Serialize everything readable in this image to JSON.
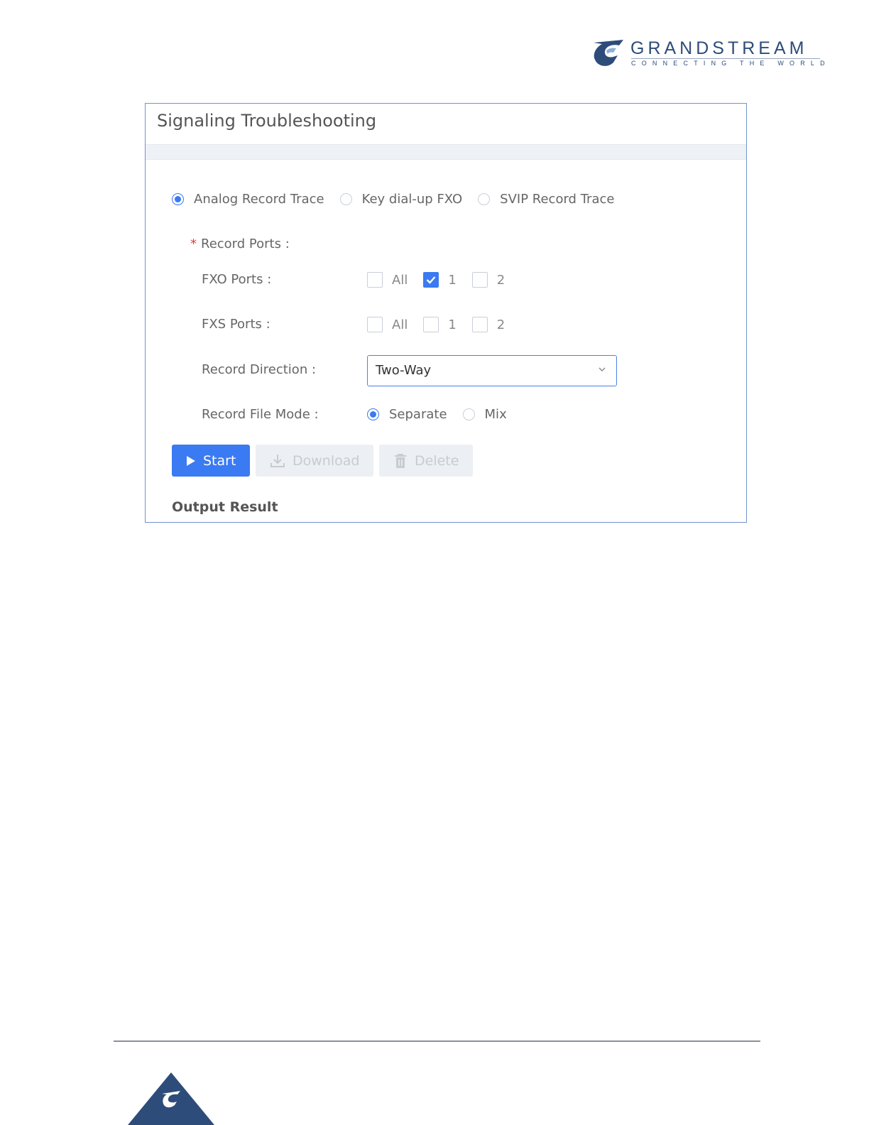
{
  "logo": {
    "brand": "GRANDSTREAM",
    "tagline": "CONNECTING THE WORLD",
    "mark_icon": "grandstream-logo-icon",
    "color": "#2e4c7a"
  },
  "panel": {
    "title": "Signaling Troubleshooting",
    "mode_options": [
      {
        "label": "Analog Record Trace",
        "selected": true
      },
      {
        "label": "Key dial-up FXO",
        "selected": false
      },
      {
        "label": "SVIP Record Trace",
        "selected": false
      }
    ],
    "record_ports_label": "Record Ports",
    "required_marker": "*",
    "fxo": {
      "label": "FXO Ports",
      "options": [
        {
          "label": "All",
          "checked": false
        },
        {
          "label": "1",
          "checked": true
        },
        {
          "label": "2",
          "checked": false
        }
      ]
    },
    "fxs": {
      "label": "FXS Ports",
      "options": [
        {
          "label": "All",
          "checked": false
        },
        {
          "label": "1",
          "checked": false
        },
        {
          "label": "2",
          "checked": false
        }
      ]
    },
    "direction": {
      "label": "Record Direction",
      "value": "Two-Way"
    },
    "file_mode": {
      "label": "Record File Mode",
      "options": [
        {
          "label": "Separate",
          "selected": true
        },
        {
          "label": "Mix",
          "selected": false
        }
      ]
    },
    "buttons": {
      "start": "Start",
      "download": "Download",
      "delete": "Delete"
    },
    "output_title": "Output Result",
    "colors": {
      "accent": "#3a7af2",
      "border": "#6f93c9",
      "disabled": "#eceff3"
    }
  }
}
